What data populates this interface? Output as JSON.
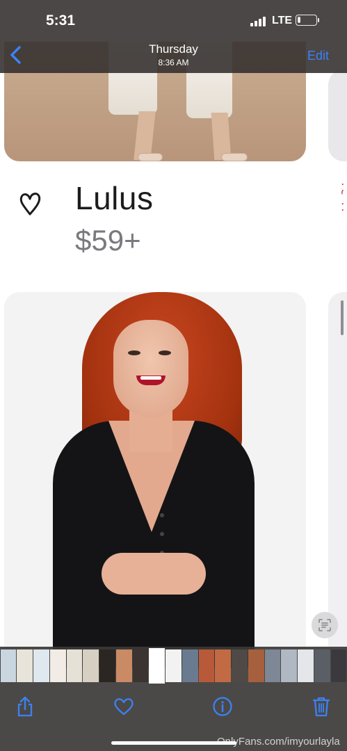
{
  "status_bar": {
    "time": "5:31",
    "network": "LTE",
    "battery_level": 0.15
  },
  "nav": {
    "title": "Thursday",
    "subtitle": "8:36 AM",
    "edit_label": "Edit"
  },
  "listing": {
    "brand": "Lulus",
    "price": "$59+"
  },
  "watermark": "OnlyFans.com/imyourlayla",
  "thumbnails": [
    {
      "color": "#c9d6e0"
    },
    {
      "color": "#e9e4da"
    },
    {
      "color": "#dfe8ee"
    },
    {
      "color": "#f1ede6"
    },
    {
      "color": "#e6e1d6"
    },
    {
      "color": "#d8cfc3"
    },
    {
      "color": "#2b2622"
    },
    {
      "color": "#c98a65"
    },
    {
      "color": "#3b3430"
    },
    {
      "color": "#ffffff"
    },
    {
      "color": "#f2f2f2"
    },
    {
      "color": "#6a7b90"
    },
    {
      "color": "#b85a3a"
    },
    {
      "color": "#c26a44"
    },
    {
      "color": "#4f4a46"
    },
    {
      "color": "#a6603e"
    },
    {
      "color": "#7e8796"
    },
    {
      "color": "#b0b8c4"
    },
    {
      "color": "#e4e6ea"
    },
    {
      "color": "#5a5f66"
    },
    {
      "color": "#3a3a3e"
    }
  ],
  "selected_thumbnail": 9,
  "colors": {
    "accent": "#3b82f6",
    "overlay": "#322e2c",
    "hair": "#b23a14",
    "dress": "#141416"
  }
}
